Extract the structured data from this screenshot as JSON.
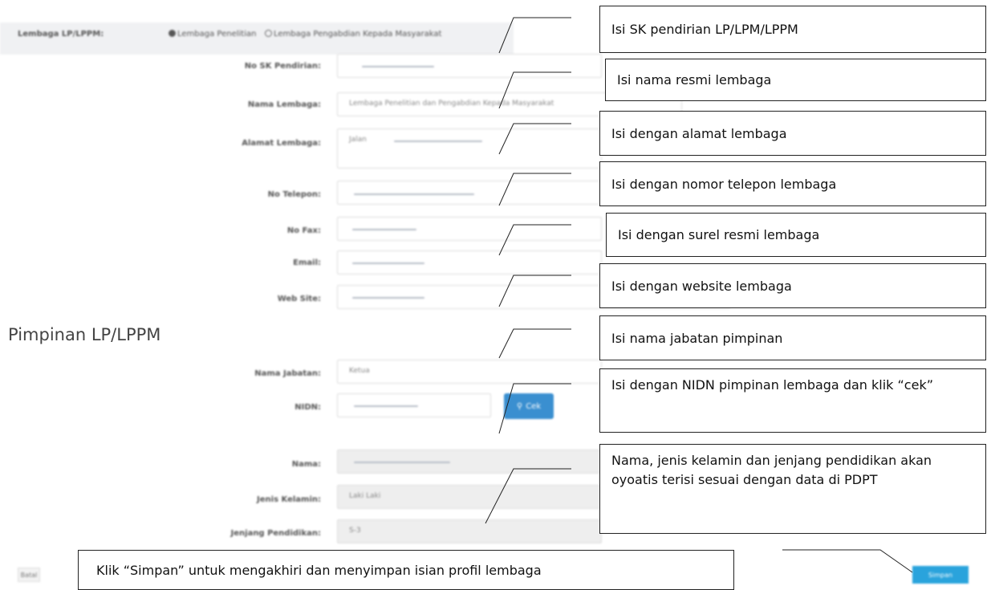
{
  "top": {
    "label": "Lembaga LP/LPPM:",
    "options": [
      "Lembaga Penelitian",
      "Lembaga Pengabdian Kepada Masyarakat"
    ]
  },
  "fields": [
    {
      "label": "No SK Pendirian:",
      "value": ""
    },
    {
      "label": "Nama Lembaga:",
      "value": "Lembaga Penelitian dan Pengabdian Kepada Masyarakat"
    },
    {
      "label": "Alamat Lembaga:",
      "value": "Jalan"
    },
    {
      "label": "No Telepon:",
      "value": ""
    },
    {
      "label": "No Fax:",
      "value": ""
    },
    {
      "label": "Email:",
      "value": ""
    },
    {
      "label": "Web Site:",
      "value": ""
    }
  ],
  "section_title": "Pimpinan LP/LPPM",
  "leader_fields": [
    {
      "label": "Nama Jabatan:",
      "value": "Ketua"
    },
    {
      "label": "NIDN:",
      "value": ""
    },
    {
      "label": "Nama:",
      "value": ""
    },
    {
      "label": "Jenis Kelamin:",
      "value": "Laki Laki"
    },
    {
      "label": "Jenjang Pendidikan:",
      "value": "S-3"
    }
  ],
  "cek_label": "Cek",
  "batal_label": "Batal",
  "simpan_label": "Simpan",
  "callouts": [
    "Isi SK pendirian LP/LPM/LPPM",
    "Isi nama resmi lembaga",
    "Isi dengan alamat lembaga",
    "Isi dengan nomor telepon lembaga",
    "Isi dengan surel resmi lembaga",
    "Isi dengan website lembaga",
    "Isi nama jabatan pimpinan",
    "Isi dengan NIDN pimpinan lembaga dan klik “cek”",
    "Nama, jenis kelamin dan jenjang pendidikan akan oyoatis terisi sesuai dengan data di PDPT",
    "Klik “Simpan” untuk mengakhiri dan menyimpan isian profil lembaga"
  ]
}
